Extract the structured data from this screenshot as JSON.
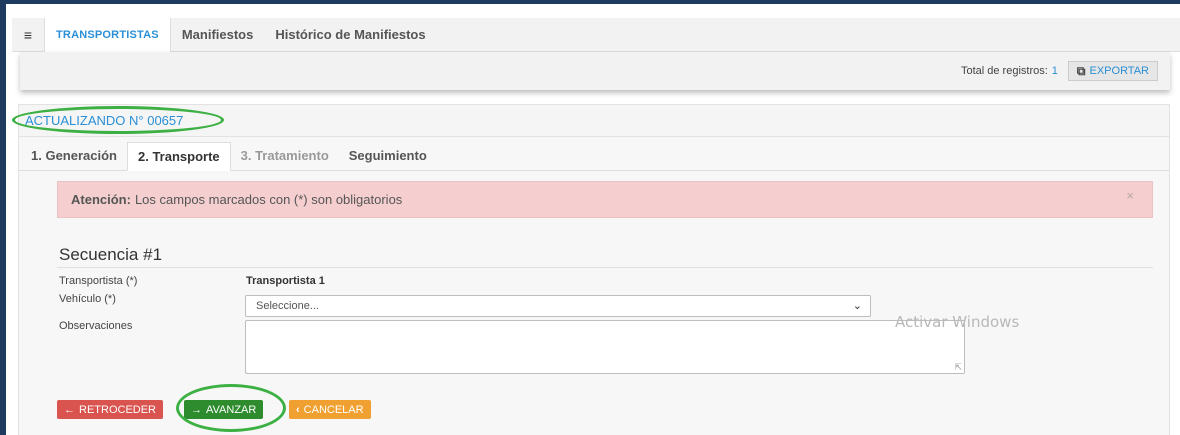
{
  "nav": {
    "tabs": [
      {
        "label": "TRANSPORTISTAS",
        "active": true
      },
      {
        "label": "Manifiestos",
        "active": false
      },
      {
        "label": "Histórico de Manifiestos",
        "active": false
      }
    ]
  },
  "records": {
    "label": "Total de registros:",
    "count": "1",
    "export_label": "EXPORTAR"
  },
  "panel": {
    "title": "ACTUALIZANDO N° 00657",
    "steps": [
      {
        "label": "1. Generación",
        "state": "normal"
      },
      {
        "label": "2. Transporte",
        "state": "active"
      },
      {
        "label": "3. Tratamiento",
        "state": "disabled"
      },
      {
        "label": "Seguimiento",
        "state": "normal"
      }
    ]
  },
  "alert": {
    "strong": "Atención:",
    "text": "Los campos marcados con (*) son obligatorios",
    "close": "×"
  },
  "form": {
    "sequence_title": "Secuencia #1",
    "carrier_label": "Transportista (*)",
    "carrier_value": "Transportista 1",
    "vehicle_label": "Vehículo (*)",
    "vehicle_selected": "Seleccione...",
    "notes_label": "Observaciones"
  },
  "actions": {
    "back": "RETROCEDER",
    "next": "AVANZAR",
    "cancel": "CANCELAR"
  },
  "watermark": "Activar Windows",
  "colors": {
    "accent": "#2a8fd6",
    "annotation": "#3cb043",
    "danger": "#d9534f",
    "success": "#2e8b2e",
    "warning": "#f0a030"
  }
}
